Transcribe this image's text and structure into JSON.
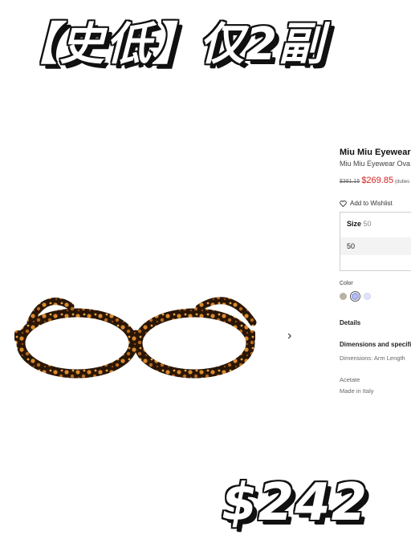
{
  "overlay": {
    "title": "【史低】仅2副",
    "price": "$242"
  },
  "product": {
    "brand": "Miu Miu Eyewear",
    "name": "Miu Miu Eyewear Ova",
    "old_price": "$381.15",
    "new_price": "$269.85",
    "duties_note": "(duties",
    "wishlist_label": "Add to Wishlist",
    "size_label": "Size",
    "size_value": "50",
    "size_option": "50",
    "color_label": "Color",
    "color_swatches": [
      "#b8b2a4",
      "#9fb0ef",
      "#d7e2f6"
    ],
    "details_label": "Details",
    "dimensions_label": "Dimensions and specific",
    "dimensions_text": "Dimensions: Arm Length",
    "material": "Acetate",
    "origin": "Made in Italy"
  },
  "gallery": {
    "next_icon": "chevron-right-icon",
    "next_glyph": "›"
  },
  "colors": {
    "sale_price": "#d32020",
    "tortoise_dark": "#2a1606",
    "tortoise_light": "#d98a2b"
  }
}
